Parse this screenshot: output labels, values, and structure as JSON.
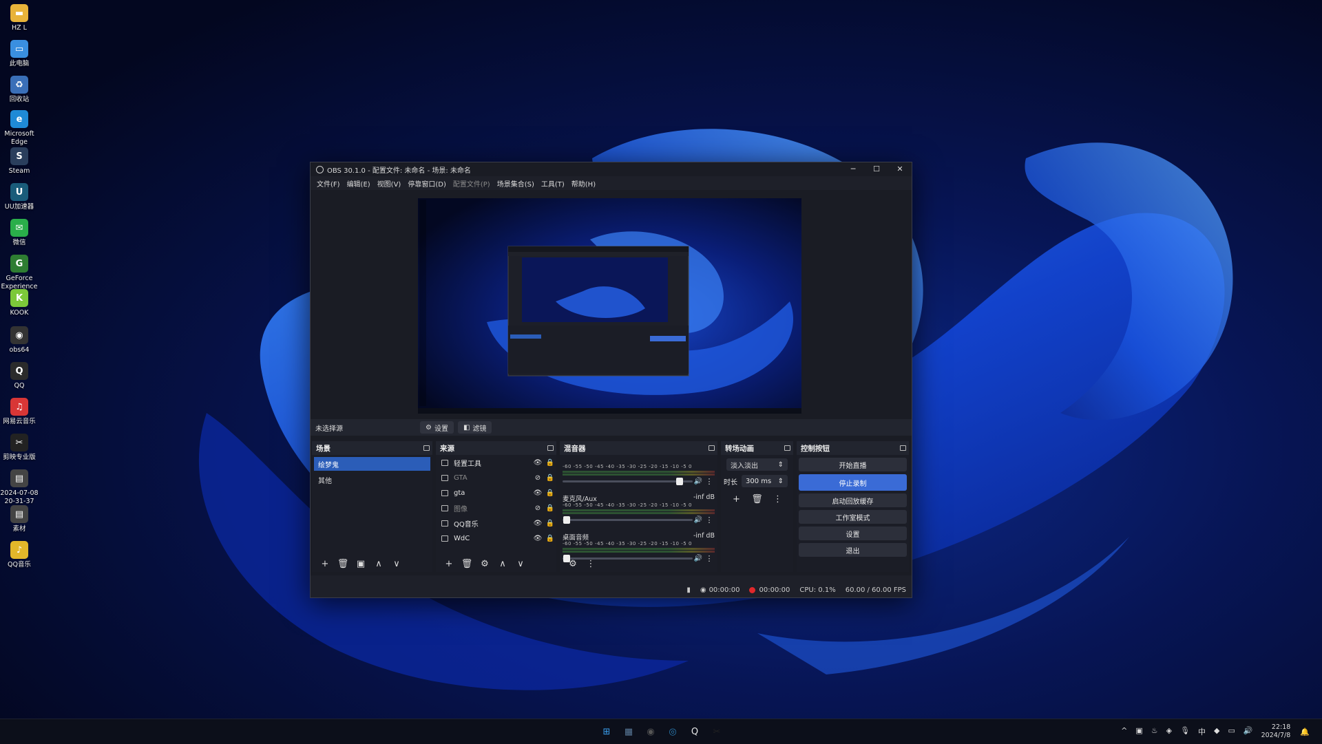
{
  "desktop": {
    "icons": [
      {
        "label": "HZ L",
        "glyph": "▬",
        "color": "#e8b33a"
      },
      {
        "label": "此电脑",
        "glyph": "▭",
        "color": "#3a8fe0"
      },
      {
        "label": "回收站",
        "glyph": "♻",
        "color": "#3a6fb8"
      },
      {
        "label": "Microsoft Edge",
        "glyph": "e",
        "color": "#1f8ad6"
      },
      {
        "label": "Steam",
        "glyph": "S",
        "color": "#2a3e5c"
      },
      {
        "label": "UU加速器",
        "glyph": "U",
        "color": "#1a5c7a"
      },
      {
        "label": "微信",
        "glyph": "✉",
        "color": "#2aae4a"
      },
      {
        "label": "GeForce Experience",
        "glyph": "G",
        "color": "#2e7d32"
      },
      {
        "label": "KOOK",
        "glyph": "K",
        "color": "#7cc83a"
      },
      {
        "label": "obs64",
        "glyph": "◉",
        "color": "#333"
      },
      {
        "label": "QQ",
        "glyph": "Q",
        "color": "#2b2b2b"
      },
      {
        "label": "网易云音乐",
        "glyph": "♫",
        "color": "#d83636"
      },
      {
        "label": "剪映专业版",
        "glyph": "✂",
        "color": "#222"
      },
      {
        "label": "2024-07-08 20-31-37",
        "glyph": "▤",
        "color": "#444"
      },
      {
        "label": "素材",
        "glyph": "▤",
        "color": "#444"
      },
      {
        "label": "QQ音乐",
        "glyph": "♪",
        "color": "#e3b72a"
      }
    ]
  },
  "window": {
    "title": "OBS 30.1.0 - 配置文件: 未命名 - 场景: 未命名",
    "controls": {
      "minimize": "─",
      "maximize": "☐",
      "close": "✕"
    },
    "menu": [
      {
        "label": "文件(F)",
        "dim": false
      },
      {
        "label": "编辑(E)",
        "dim": false
      },
      {
        "label": "视图(V)",
        "dim": false
      },
      {
        "label": "停靠窗口(D)",
        "dim": false
      },
      {
        "label": "配置文件(P)",
        "dim": true
      },
      {
        "label": "场景集合(S)",
        "dim": false
      },
      {
        "label": "工具(T)",
        "dim": false
      },
      {
        "label": "帮助(H)",
        "dim": false
      }
    ]
  },
  "selection_bar": {
    "no_source": "未选择源",
    "settings_label": "设置",
    "filters_label": "滤镜"
  },
  "scenes": {
    "title": "场景",
    "items": [
      {
        "label": "绘梦鬼",
        "active": true
      },
      {
        "label": "其他",
        "active": false
      }
    ],
    "toolbar": [
      "+",
      "🗑",
      "▣",
      "∧",
      "∨"
    ]
  },
  "sources": {
    "title": "来源",
    "items": [
      {
        "label": "轻置工具",
        "dim": false,
        "visible": true
      },
      {
        "label": "GTA",
        "dim": true,
        "visible": false
      },
      {
        "label": "gta",
        "dim": false,
        "visible": true
      },
      {
        "label": "图像",
        "dim": true,
        "visible": false
      },
      {
        "label": "QQ音乐",
        "dim": false,
        "visible": true
      },
      {
        "label": "WdC",
        "dim": false,
        "visible": true
      }
    ],
    "toolbar": [
      "+",
      "🗑",
      "⚙",
      "∧",
      "∨"
    ]
  },
  "mixer": {
    "title": "混音器",
    "scale": "-60 -55 -50 -45 -40 -35 -30 -25 -20 -15 -10 -5 0",
    "tracks": [
      {
        "name": "",
        "db": "",
        "level": 0.9
      },
      {
        "name": "麦克风/Aux",
        "db": "-inf dB",
        "level": 0.03
      },
      {
        "name": "桌面音频",
        "db": "-inf dB",
        "level": 0.03
      }
    ],
    "toolbar": [
      "⚙",
      "⋮"
    ]
  },
  "transitions": {
    "title": "转场动画",
    "selected": "淡入淡出",
    "duration_label": "时长",
    "duration_value": "300 ms",
    "toolbar": [
      "+",
      "🗑",
      "⋮"
    ]
  },
  "controls": {
    "title": "控制按钮",
    "buttons": [
      {
        "label": "开始直播",
        "active": false
      },
      {
        "label": "停止录制",
        "active": true
      },
      {
        "label": "启动回放缓存",
        "active": false
      },
      {
        "label": "工作室模式",
        "active": false
      },
      {
        "label": "设置",
        "active": false
      },
      {
        "label": "退出",
        "active": false
      }
    ]
  },
  "status": {
    "stream_time": "00:00:00",
    "rec_time": "00:00:00",
    "cpu": "CPU: 0.1%",
    "fps": "60.00 / 60.00 FPS"
  },
  "taskbar": {
    "apps": [
      {
        "glyph": "⊞",
        "color": "#3aa0f0"
      },
      {
        "glyph": "▦",
        "color": "#5a7a9a"
      },
      {
        "glyph": "◉",
        "color": "#555"
      },
      {
        "glyph": "◎",
        "color": "#2b7fb8"
      },
      {
        "glyph": "Q",
        "color": "#e8e8e8"
      },
      {
        "glyph": "✂",
        "color": "#222"
      }
    ],
    "tray": [
      "^",
      "▣",
      "♨",
      "◈",
      "🎙",
      "中",
      "◆",
      "▭",
      "🔊"
    ],
    "time": "22:18",
    "date": "2024/7/8"
  }
}
